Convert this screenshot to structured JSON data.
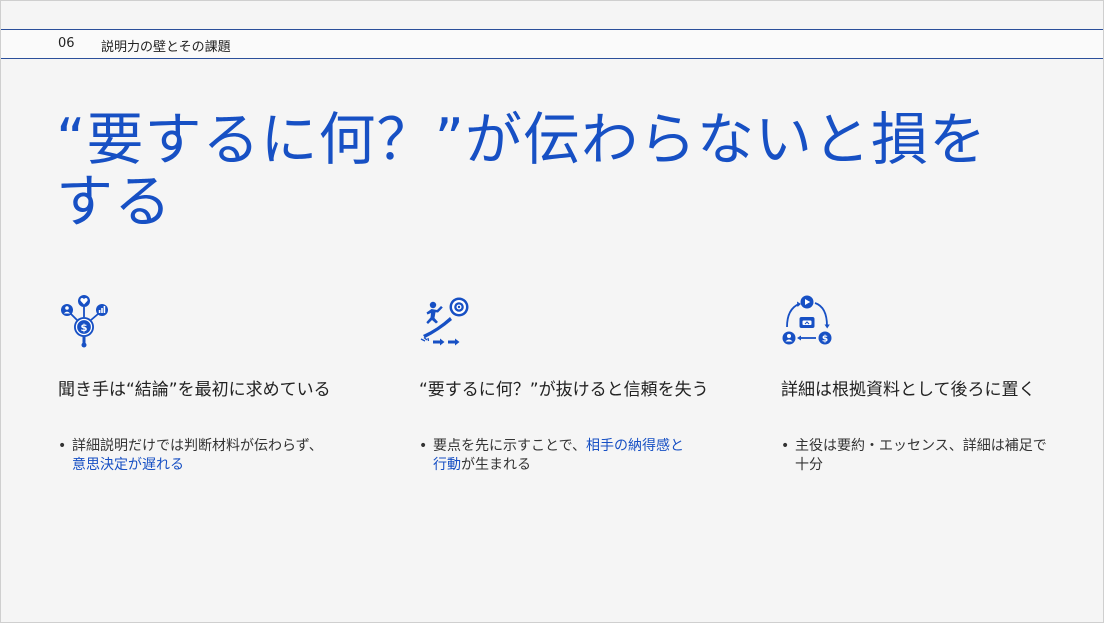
{
  "header": {
    "number": "06",
    "title": "説明力の壁とその課題"
  },
  "main": {
    "title_line1": "“要するに何？”が伝わらないと損を",
    "title_line2": "する"
  },
  "columns": [
    {
      "icon": "people-money-insight-icon",
      "heading": "聞き手は“結論”を最初に求めている",
      "bullet_plain": "詳細説明だけでは判断材料が伝わらず、",
      "bullet_highlight": "意思決定が遅れる",
      "bullet_tail": ""
    },
    {
      "icon": "runner-target-icon",
      "heading": "“要するに何？”が抜けると信頼を失う",
      "bullet_plain": "要点を先に示すことで、",
      "bullet_highlight": "相手の納得感と行動",
      "bullet_tail": "が生まれる"
    },
    {
      "icon": "cycle-process-icon",
      "heading": "詳細は根拠資料として後ろに置く",
      "bullet_plain": "主役は要約・エッセンス、詳細は補足で十分",
      "bullet_highlight": "",
      "bullet_tail": ""
    }
  ],
  "bullet_symbol": "•",
  "colors": {
    "accent": "#1750c4",
    "header_line": "#2b4f9a",
    "background": "#f5f5f5"
  }
}
